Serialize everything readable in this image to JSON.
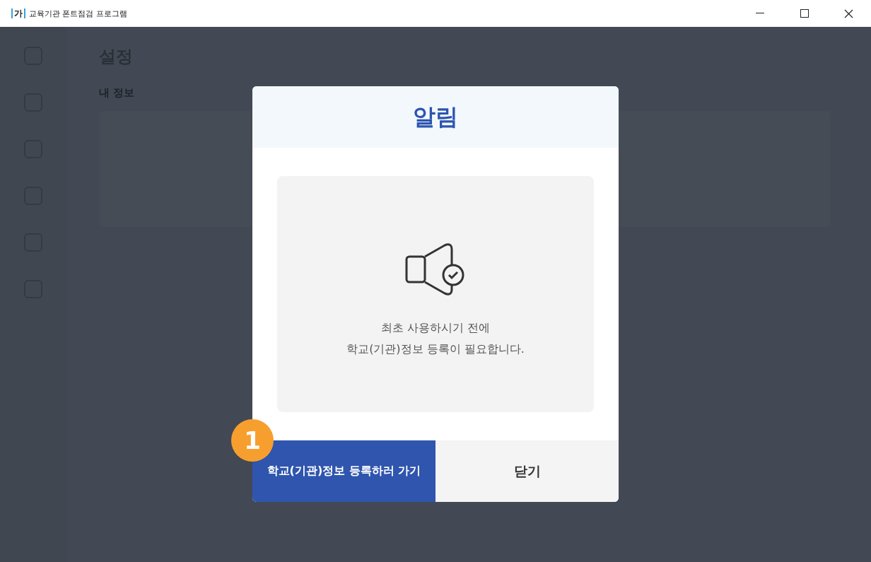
{
  "window": {
    "title": "교육기관 폰트점검 프로그램",
    "logo": "가"
  },
  "background": {
    "page_title": "설정",
    "section_title": "내 정보"
  },
  "dialog": {
    "title": "알림",
    "message_lines": [
      "최초 사용하시기 전에",
      "학교(기관)정보 등록이 필요합니다."
    ],
    "buttons": [
      {
        "label": "학교(기관)정보 등록하러 가기",
        "kind": "primary"
      },
      {
        "label": "닫기",
        "kind": "secondary"
      }
    ],
    "step_badge": "1"
  }
}
